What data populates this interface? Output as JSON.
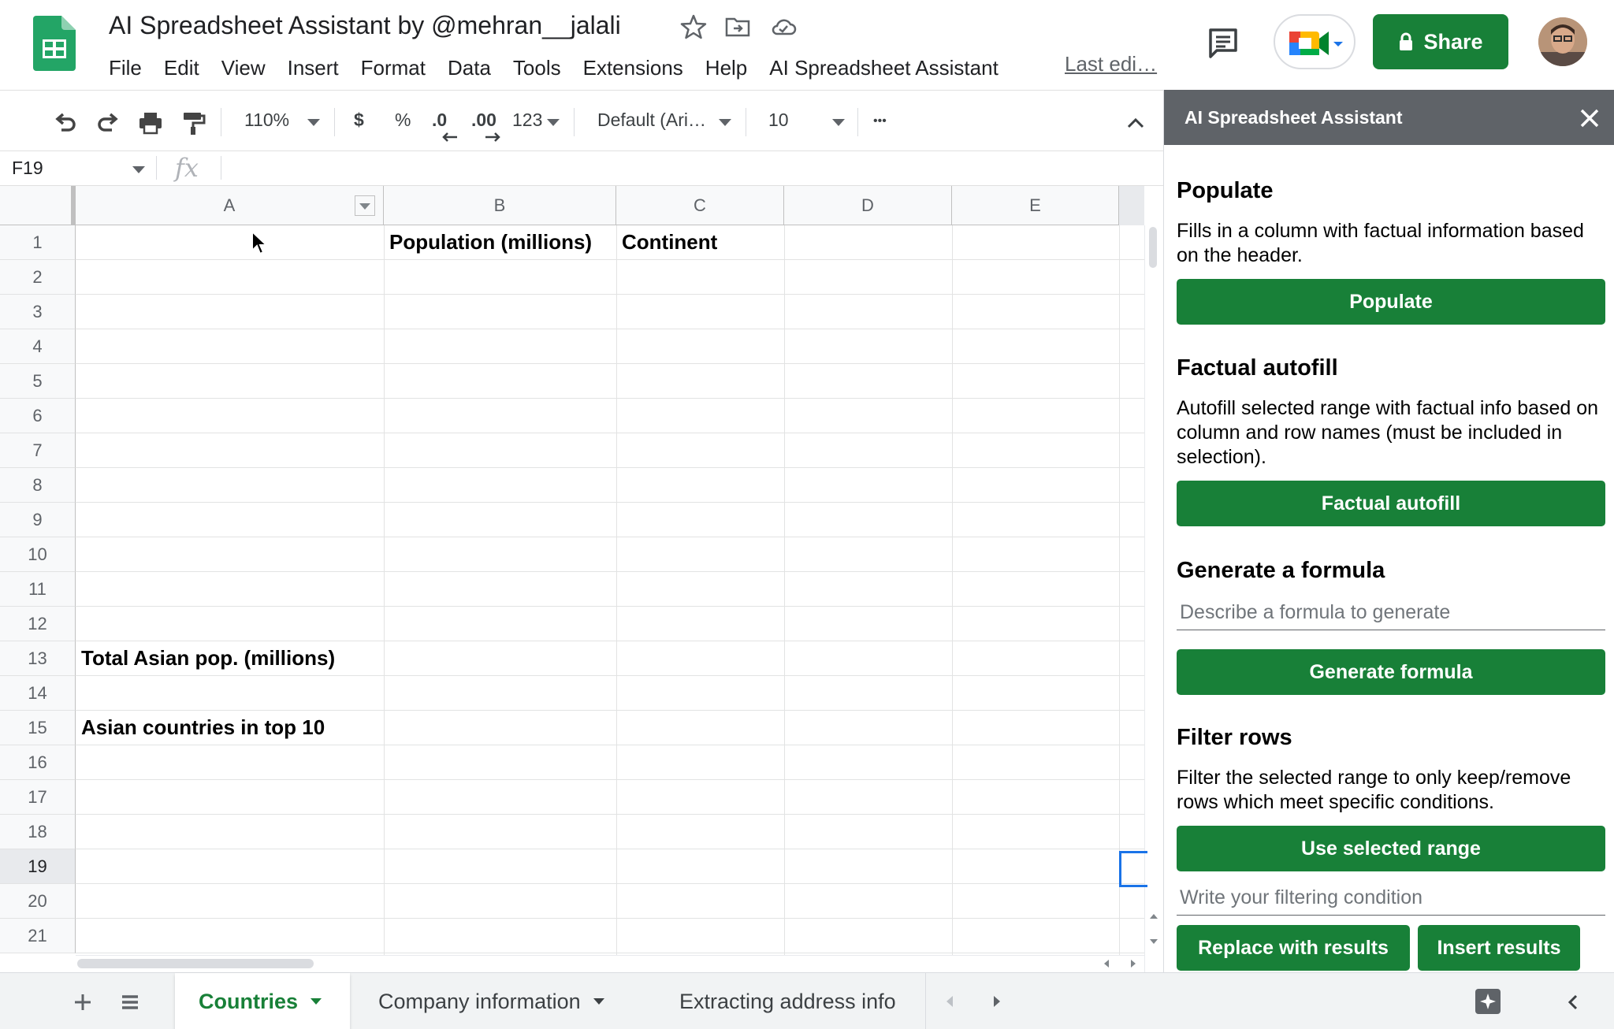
{
  "colors": {
    "accent_green": "#188038",
    "panel_header": "#5f6368",
    "selection_blue": "#1a73e8"
  },
  "header": {
    "title": "AI Spreadsheet Assistant by @mehran__jalali",
    "icons": [
      "star-icon",
      "move-to-folder-icon",
      "cloud-status-icon"
    ],
    "menu": [
      "File",
      "Edit",
      "View",
      "Insert",
      "Format",
      "Data",
      "Tools",
      "Extensions",
      "Help",
      "AI Spreadsheet Assistant"
    ],
    "last_edit": "Last edi…",
    "share_label": "Share"
  },
  "toolbar": {
    "zoom": "110%",
    "currency": "$",
    "percent": "%",
    "decrease_decimal": ".0",
    "increase_decimal": ".00",
    "number_format": "123",
    "font": "Default (Ari…",
    "font_size": "10",
    "more": "•••"
  },
  "formula_bar": {
    "name_box": "F19",
    "fx": "fx"
  },
  "sheet": {
    "columns": [
      "A",
      "B",
      "C",
      "D",
      "E"
    ],
    "rows": [
      "1",
      "2",
      "3",
      "4",
      "5",
      "6",
      "7",
      "8",
      "9",
      "10",
      "11",
      "12",
      "13",
      "14",
      "15",
      "16",
      "17",
      "18",
      "19",
      "20",
      "21"
    ],
    "selected_cell": "F19",
    "cells": {
      "B1": "Population (millions)",
      "C1": "Continent",
      "A13": "Total Asian pop. (millions)",
      "A15": "Asian countries in top 10"
    }
  },
  "tabs": [
    {
      "label": "Countries",
      "active": true
    },
    {
      "label": "Company information",
      "active": false
    },
    {
      "label": "Extracting address info",
      "active": false
    }
  ],
  "panel": {
    "title": "AI Spreadsheet Assistant",
    "populate": {
      "title": "Populate",
      "desc": "Fills in a column with factual information based on the header.",
      "button": "Populate"
    },
    "autofill": {
      "title": "Factual autofill",
      "desc": "Autofill selected range with factual info based on column and row names (must be included in selection).",
      "button": "Factual autofill"
    },
    "formula": {
      "title": "Generate a formula",
      "placeholder": "Describe a formula to generate",
      "button": "Generate formula"
    },
    "filter": {
      "title": "Filter rows",
      "desc": "Filter the selected range to only keep/remove rows which meet specific conditions.",
      "use_range_button": "Use selected range",
      "placeholder": "Write your filtering condition",
      "replace_button": "Replace with results",
      "insert_button": "Insert results"
    }
  }
}
